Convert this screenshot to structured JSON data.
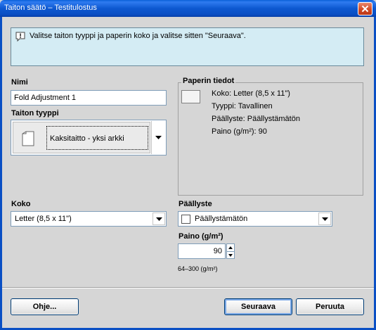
{
  "window": {
    "title": "Taiton säätö – Testitulostus"
  },
  "instruction": {
    "text": "Valitse taiton tyyppi ja paperin koko ja valitse sitten \"Seuraava\"."
  },
  "name_field": {
    "label": "Nimi",
    "value": "Fold Adjustment 1"
  },
  "fold_type": {
    "label": "Taiton tyyppi",
    "value": "Kaksitaitto - yksi arkki"
  },
  "paper_info": {
    "legend": "Paperin tiedot",
    "size": "Koko: Letter (8,5 x 11\")",
    "type": "Tyyppi: Tavallinen",
    "coating": "Päällyste: Päällystämätön",
    "weight": "Paino (g/m²): 90"
  },
  "size_field": {
    "label": "Koko",
    "value": "Letter (8,5 x 11\")"
  },
  "coating_field": {
    "label": "Päällyste",
    "value": "Päällystämätön"
  },
  "weight_field": {
    "label": "Paino (g/m²)",
    "value": "90",
    "range": "64–300 (g/m²)"
  },
  "buttons": {
    "help": "Ohje...",
    "next": "Seuraava",
    "cancel": "Peruuta"
  },
  "colors": {
    "titlebar": "#0a5fd8",
    "info_background": "#d4ecf4",
    "dialog_background": "#d6d6d6"
  }
}
